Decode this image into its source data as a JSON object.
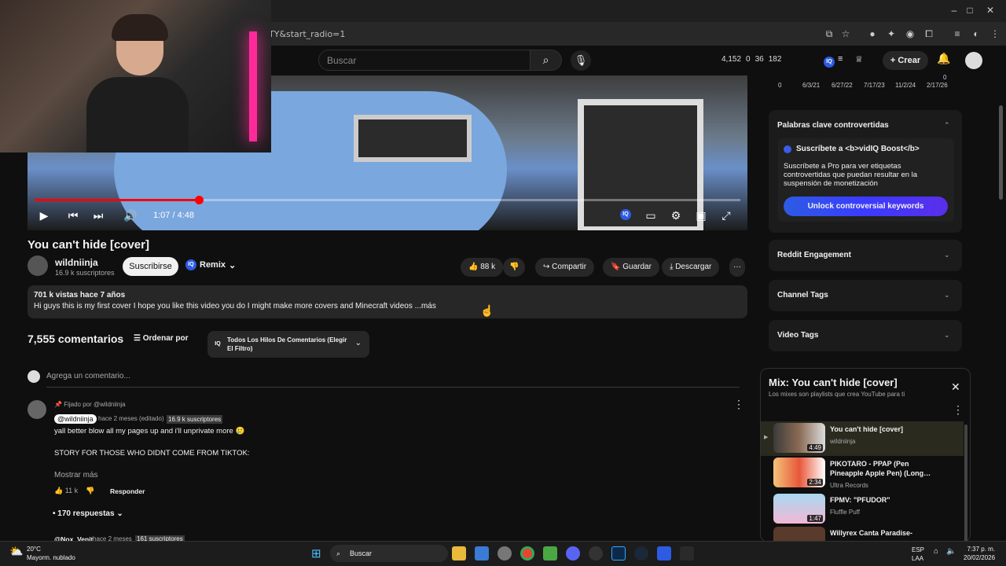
{
  "browser": {
    "url": "TY&start_radio=1"
  },
  "header": {
    "search_placeholder": "Buscar",
    "stats": [
      "4,152",
      "0",
      "36",
      "182"
    ],
    "create_label": "Crear"
  },
  "player": {
    "time": "1:07 / 4:48",
    "progress": 0.233
  },
  "video": {
    "title": "You can't hide [cover]",
    "channel": "wildniinja",
    "subscribers": "16.9 k suscriptores",
    "subscribe_label": "Suscribirse",
    "remix_label": "Remix",
    "likes": "88 k",
    "share_label": "Compartir",
    "save_label": "Guardar",
    "download_label": "Descargar",
    "desc_meta": "701 k vistas  hace 7 años",
    "desc_text": "Hi guys this is my first cover I hope you like this video you do I might make more covers and Minecraft videos ...más"
  },
  "comments": {
    "count": "7,555 comentarios",
    "sort_label": "Ordenar por",
    "filter_label": "Todos Los Hilos De Comentarios (Elegir El Filtro)",
    "add_placeholder": "Agrega un comentario...",
    "pinned": "Fijado por @wildniinja",
    "c1_author": "@wildniinja",
    "c1_when": "hace 2 meses (editado)",
    "c1_subs": "16.9 k suscriptores",
    "c1_text1": "yall better blow all my pages up and i'll unprivate more 🥲",
    "c1_text2": "STORY FOR THOSE WHO DIDNT COME FROM TIKTOK:",
    "c1_more": "Mostrar más",
    "c1_likes": "11 k",
    "reply_label": "Responder",
    "replies": "• 170 respuestas",
    "c2_author": "@Nox_Venit",
    "c2_when": "hace 2 meses",
    "c2_subs": "161 suscriptores"
  },
  "sidebar": {
    "chart_axis": [
      "0",
      "6/3/21",
      "6/27/22",
      "7/17/23",
      "11/2/24",
      "2/17/26"
    ],
    "chart_top_label": "0",
    "keywords_title": "Palabras clave controvertidas",
    "boost_title": "Suscríbete a <b>vidIQ Boost</b>",
    "boost_body": "Suscríbete a Pro para ver etiquetas controvertidas que puedan resultar en la suspensión de monetización",
    "unlock_label": "Unlock controversial keywords",
    "reddit_title": "Reddit Engagement",
    "channel_tags_title": "Channel Tags",
    "video_tags_title": "Video Tags"
  },
  "mix": {
    "title": "Mix: You can't hide [cover]",
    "subtitle": "Los mixes son playlists que crea YouTube para ti",
    "items": [
      {
        "title": "You can't hide [cover]",
        "author": "wildniinja",
        "duration": "4:49"
      },
      {
        "title": "PIKOTARO - PPAP (Pen Pineapple Apple Pen) (Long…",
        "author": "Ultra Records",
        "duration": "2:34"
      },
      {
        "title": "FPMV: \"PFUDOR\"",
        "author": "Fluffle Puff",
        "duration": "1:47"
      },
      {
        "title": "Willyrex Canta Paradise-",
        "author": "",
        "duration": ""
      }
    ]
  },
  "taskbar": {
    "temp": "20°C",
    "weather": "Mayorm. nublado",
    "search": "Buscar",
    "lang1": "ESP",
    "lang2": "LAA",
    "time": "7:37 p. m.",
    "date": "20/02/2026"
  },
  "colors": {
    "accent": "#ff0000",
    "vidiq": "#2d5be3"
  }
}
